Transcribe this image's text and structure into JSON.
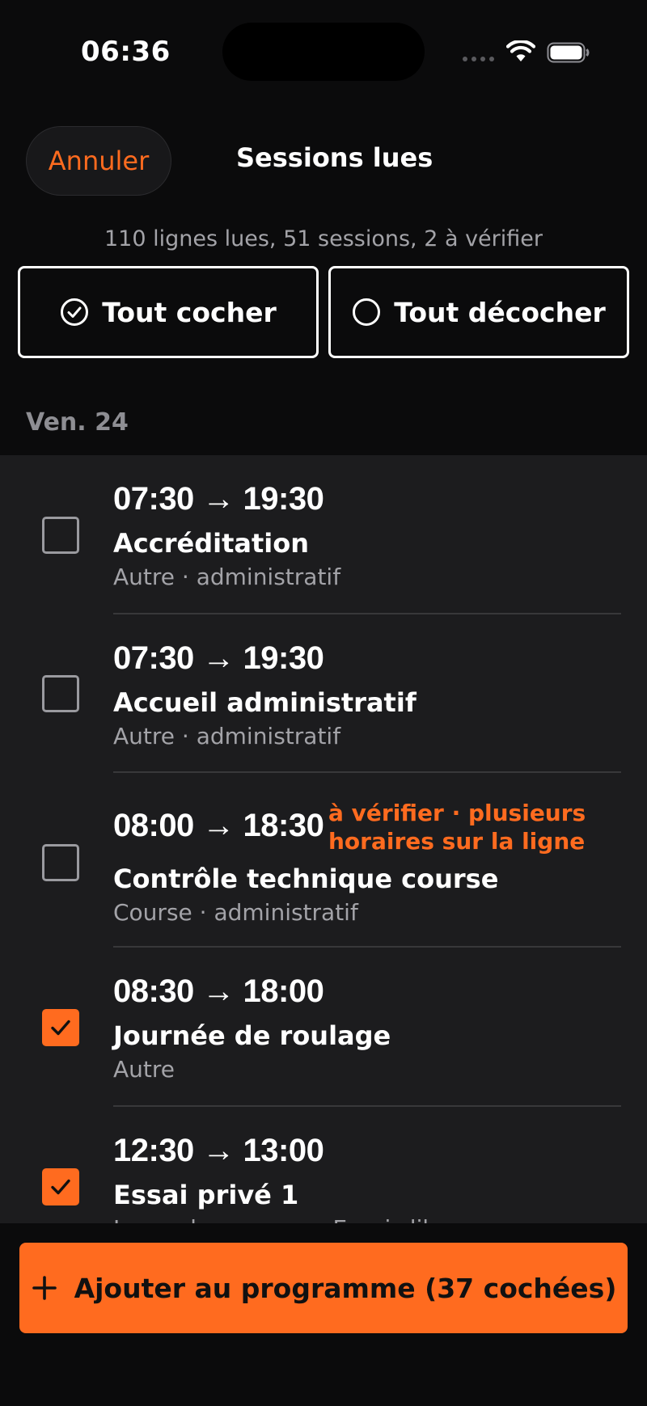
{
  "status_bar": {
    "time": "06:36"
  },
  "header": {
    "cancel_label": "Annuler",
    "title": "Sessions lues",
    "summary": "110 lignes lues, 51 sessions, 2 à vérifier"
  },
  "bulk_actions": {
    "check_all_label": "Tout cocher",
    "uncheck_all_label": "Tout décocher"
  },
  "section": {
    "label": "Ven. 24"
  },
  "sessions": [
    {
      "time": "07:30 → 19:30",
      "name": "Accréditation",
      "meta": "Autre · administratif",
      "checked": false,
      "warning": ""
    },
    {
      "time": "07:30 → 19:30",
      "name": "Accueil administratif",
      "meta": "Autre · administratif",
      "checked": false,
      "warning": ""
    },
    {
      "time": "08:00 → 18:30",
      "name": "Contrôle technique course",
      "meta": "Course · administratif",
      "checked": false,
      "warning": "à vérifier · plusieurs horaires sur la ligne"
    },
    {
      "time": "08:30 → 18:00",
      "name": "Journée de roulage",
      "meta": "Autre",
      "checked": true,
      "warning": ""
    },
    {
      "time": "12:30 → 13:00",
      "name": "Essai privé 1",
      "meta": "Legends cars cup · Essais libres",
      "checked": true,
      "warning": ""
    }
  ],
  "footer": {
    "add_label": "Ajouter au programme (37 cochées)"
  },
  "colors": {
    "accent": "#ff6b1f",
    "background": "#0b0b0c",
    "list_background": "#1c1c1e"
  }
}
